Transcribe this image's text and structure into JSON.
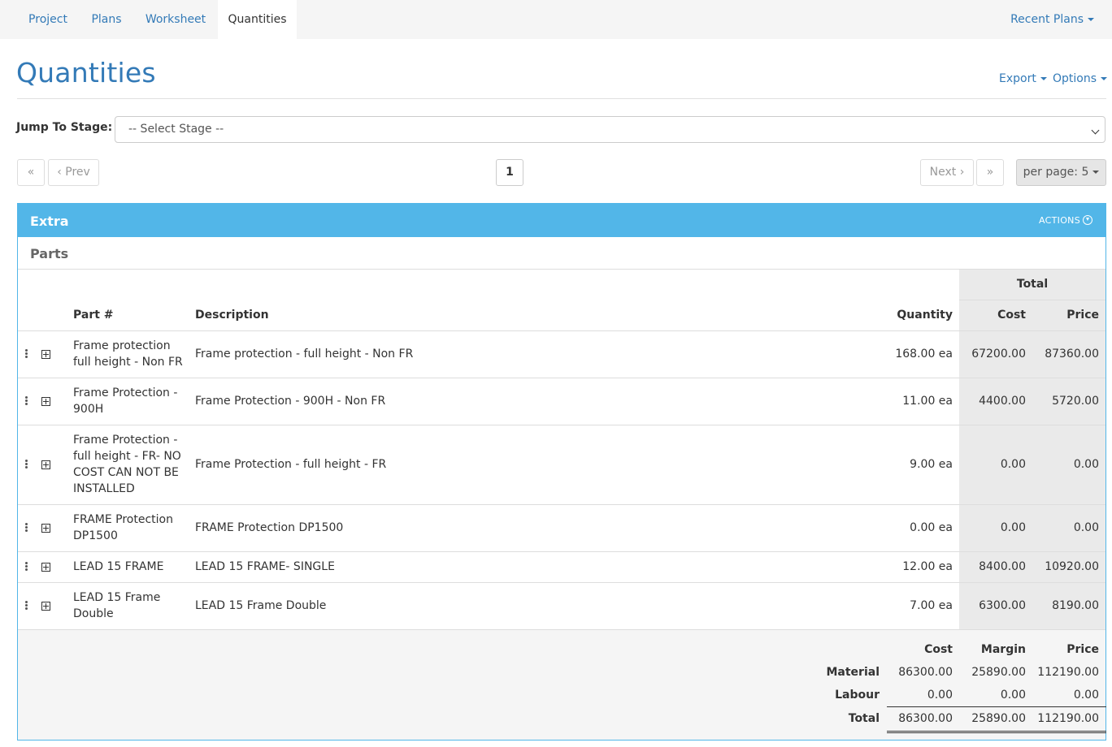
{
  "nav": {
    "tabs": [
      {
        "label": "Project"
      },
      {
        "label": "Plans"
      },
      {
        "label": "Worksheet"
      },
      {
        "label": "Quantities"
      }
    ],
    "recent": "Recent Plans"
  },
  "header": {
    "title": "Quantities",
    "export": "Export",
    "options": "Options"
  },
  "stage": {
    "label": "Jump To Stage:",
    "selected": "-- Select Stage --"
  },
  "pagination": {
    "first": "«",
    "prev": "‹ Prev",
    "current": "1",
    "next": "Next ›",
    "last": "»",
    "per_page": "per page: 5"
  },
  "panel": {
    "title": "Extra",
    "actions": "ACTIONS",
    "section": "Parts"
  },
  "table": {
    "group_header": "Total",
    "headers": {
      "part": "Part #",
      "description": "Description",
      "quantity": "Quantity",
      "cost": "Cost",
      "price": "Price"
    },
    "rows": [
      {
        "part": "Frame protection full height - Non FR",
        "description": "Frame protection - full height - Non FR",
        "quantity": "168.00 ea",
        "cost": "67200.00",
        "price": "87360.00"
      },
      {
        "part": "Frame Protection - 900H",
        "description": "Frame Protection - 900H - Non FR",
        "quantity": "11.00 ea",
        "cost": "4400.00",
        "price": "5720.00"
      },
      {
        "part": "Frame Protection - full height - FR- NO COST CAN NOT BE INSTALLED",
        "description": "Frame Protection - full height - FR",
        "quantity": "9.00 ea",
        "cost": "0.00",
        "price": "0.00"
      },
      {
        "part": "FRAME Protection DP1500",
        "description": "FRAME Protection DP1500",
        "quantity": "0.00 ea",
        "cost": "0.00",
        "price": "0.00"
      },
      {
        "part": "LEAD 15 FRAME",
        "description": "LEAD 15 FRAME- SINGLE",
        "quantity": "12.00 ea",
        "cost": "8400.00",
        "price": "10920.00"
      },
      {
        "part": "LEAD 15 Frame Double",
        "description": "LEAD 15 Frame Double",
        "quantity": "7.00 ea",
        "cost": "6300.00",
        "price": "8190.00"
      }
    ]
  },
  "summary": {
    "headers": {
      "cost": "Cost",
      "margin": "Margin",
      "price": "Price"
    },
    "material": {
      "label": "Material",
      "cost": "86300.00",
      "margin": "25890.00",
      "price": "112190.00"
    },
    "labour": {
      "label": "Labour",
      "cost": "0.00",
      "margin": "0.00",
      "price": "0.00"
    },
    "total": {
      "label": "Total",
      "cost": "86300.00",
      "margin": "25890.00",
      "price": "112190.00"
    }
  }
}
